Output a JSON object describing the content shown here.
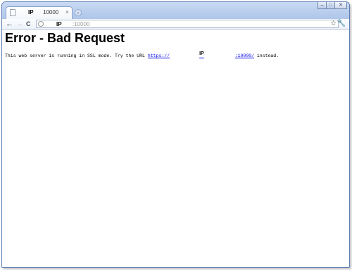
{
  "browser": {
    "tab": {
      "ip_label": "IP",
      "port_label": "10000",
      "close": "×"
    },
    "new_tab": "+",
    "window_buttons": {
      "minimize": "–",
      "maximize": "□",
      "close": "✕"
    },
    "toolbar": {
      "back": "←",
      "forward": "→",
      "reload": "C",
      "star": "☆",
      "wrench": "🔧"
    },
    "address": {
      "ip_label": "IP",
      "port": ":10000"
    }
  },
  "page": {
    "title": "Error - Bad Request",
    "message_before": "This web server is running in SSL mode. Try the URL ",
    "link_prefix": "https://",
    "link_ip": "IP",
    "link_suffix": ":10000/",
    "message_after": " instead."
  },
  "colors": {
    "link": "#0000ee",
    "frame": "#5d7fb5"
  }
}
